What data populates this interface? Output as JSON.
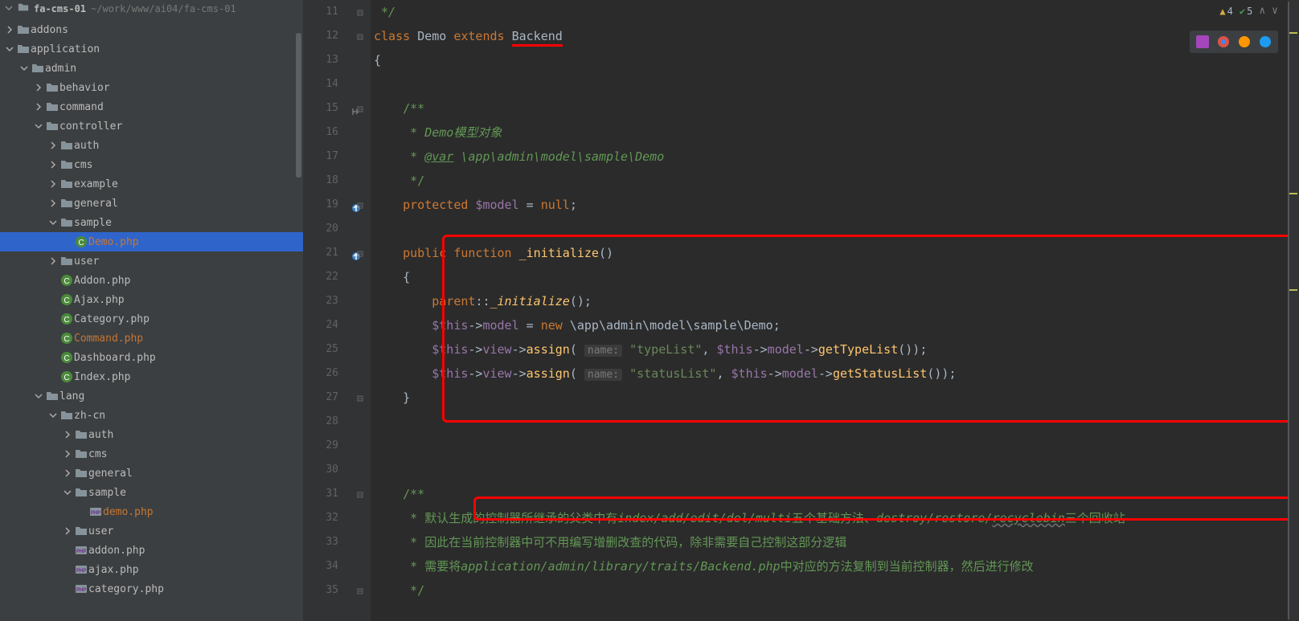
{
  "project": {
    "name": "fa-cms-01",
    "path": "~/work/www/ai04/fa-cms-01"
  },
  "inspection": {
    "warnings": 4,
    "passes": 5
  },
  "tree": [
    {
      "depth": 0,
      "chev": "right",
      "icon": "folder",
      "label": "addons",
      "interactable": true
    },
    {
      "depth": 0,
      "chev": "down",
      "icon": "folder",
      "label": "application",
      "interactable": true
    },
    {
      "depth": 1,
      "chev": "down",
      "icon": "folder",
      "label": "admin",
      "interactable": true
    },
    {
      "depth": 2,
      "chev": "right",
      "icon": "folder",
      "label": "behavior",
      "interactable": true
    },
    {
      "depth": 2,
      "chev": "right",
      "icon": "folder",
      "label": "command",
      "interactable": true
    },
    {
      "depth": 2,
      "chev": "down",
      "icon": "folder",
      "label": "controller",
      "interactable": true
    },
    {
      "depth": 3,
      "chev": "right",
      "icon": "folder",
      "label": "auth",
      "interactable": true
    },
    {
      "depth": 3,
      "chev": "right",
      "icon": "folder",
      "label": "cms",
      "interactable": true
    },
    {
      "depth": 3,
      "chev": "right",
      "icon": "folder",
      "label": "example",
      "interactable": true
    },
    {
      "depth": 3,
      "chev": "right",
      "icon": "folder",
      "label": "general",
      "interactable": true
    },
    {
      "depth": 3,
      "chev": "down",
      "icon": "folder",
      "label": "sample",
      "interactable": true
    },
    {
      "depth": 4,
      "chev": "none",
      "icon": "class",
      "label": "Demo.php",
      "interactable": true,
      "modified": true,
      "selected": true
    },
    {
      "depth": 3,
      "chev": "right",
      "icon": "folder",
      "label": "user",
      "interactable": true
    },
    {
      "depth": 3,
      "chev": "none",
      "icon": "class",
      "label": "Addon.php",
      "interactable": true
    },
    {
      "depth": 3,
      "chev": "none",
      "icon": "class",
      "label": "Ajax.php",
      "interactable": true
    },
    {
      "depth": 3,
      "chev": "none",
      "icon": "class",
      "label": "Category.php",
      "interactable": true
    },
    {
      "depth": 3,
      "chev": "none",
      "icon": "class",
      "label": "Command.php",
      "interactable": true,
      "modified": true
    },
    {
      "depth": 3,
      "chev": "none",
      "icon": "class",
      "label": "Dashboard.php",
      "interactable": true
    },
    {
      "depth": 3,
      "chev": "none",
      "icon": "class",
      "label": "Index.php",
      "interactable": true
    },
    {
      "depth": 2,
      "chev": "down",
      "icon": "folder",
      "label": "lang",
      "interactable": true
    },
    {
      "depth": 3,
      "chev": "down",
      "icon": "folder",
      "label": "zh-cn",
      "interactable": true
    },
    {
      "depth": 4,
      "chev": "right",
      "icon": "folder",
      "label": "auth",
      "interactable": true
    },
    {
      "depth": 4,
      "chev": "right",
      "icon": "folder",
      "label": "cms",
      "interactable": true
    },
    {
      "depth": 4,
      "chev": "right",
      "icon": "folder",
      "label": "general",
      "interactable": true
    },
    {
      "depth": 4,
      "chev": "down",
      "icon": "folder",
      "label": "sample",
      "interactable": true
    },
    {
      "depth": 5,
      "chev": "none",
      "icon": "php",
      "label": "demo.php",
      "interactable": true,
      "modified": true
    },
    {
      "depth": 4,
      "chev": "right",
      "icon": "folder",
      "label": "user",
      "interactable": true
    },
    {
      "depth": 4,
      "chev": "none",
      "icon": "php",
      "label": "addon.php",
      "interactable": true
    },
    {
      "depth": 4,
      "chev": "none",
      "icon": "php",
      "label": "ajax.php",
      "interactable": true
    },
    {
      "depth": 4,
      "chev": "none",
      "icon": "php",
      "label": "category.php",
      "interactable": true
    }
  ],
  "gutter": {
    "start": 11,
    "end": 35,
    "marks": {
      "15": "indent",
      "19": "override",
      "21": "override"
    },
    "folds": [
      11,
      12,
      15,
      19,
      21,
      27,
      31,
      35
    ]
  },
  "code": {
    "l11": " */",
    "l12_class": "class",
    "l12_demo": "Demo",
    "l12_extends": "extends",
    "l12_backend": "Backend",
    "l13": "{",
    "l15": "    /**",
    "l16a": "     * ",
    "l16b": "Demo模型对象",
    "l17a": "     * ",
    "l17b": "@var",
    "l17c": " \\app\\admin\\model\\sample\\Demo",
    "l18": "     */",
    "l19_prot": "    protected ",
    "l19_model": "$model",
    "l19_eq": " = ",
    "l19_null": "null",
    "l19_semi": ";",
    "l21_pub": "    public ",
    "l21_func": "function ",
    "l21_name": "_initialize",
    "l21_paren": "()",
    "l22": "    {",
    "l23_pad": "        ",
    "l23_parent": "parent",
    "l23_sc": "::",
    "l23_init": "_initialize",
    "l23_end": "();",
    "l24_pad": "        ",
    "l24_this": "$this",
    "l24_arrow": "->",
    "l24_model": "model",
    "l24_eq": " = ",
    "l24_new": "new ",
    "l24_path": "\\app\\admin\\model\\sample\\Demo",
    "l24_semi": ";",
    "l25_pad": "        ",
    "l25_this": "$this",
    "l25_view": "view",
    "l25_assign": "assign",
    "l25_hint": "name:",
    "l25_str": "\"typeList\"",
    "l25_this2": "$this",
    "l25_model2": "model",
    "l25_call": "getTypeList",
    "l26_str": "\"statusList\"",
    "l26_call": "getStatusList",
    "l27": "    }",
    "l31": "    /**",
    "l32a": "     * 默认生成的控制器所继承的父类中有",
    "l32b": "index/add/edit/del/multi",
    "l32c": "五个基础方法、",
    "l32d": "destroy/restore/",
    "l32e": "recyclebin",
    "l32f": "三个回收站",
    "l33": "     * 因此在当前控制器中可不用编写增删改查的代码，除非需要自己控制这部分逻辑",
    "l34a": "     * 需要将",
    "l34b": "application/admin/library/traits/Backend.php",
    "l34c": "中对应的方法复制到当前控制器，然后进行修改",
    "l35": "     */"
  }
}
